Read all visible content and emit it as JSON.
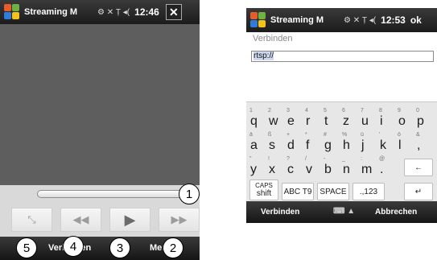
{
  "player": {
    "title": "Streaming M",
    "status_icons": "⚙ ✕ Ṭ ◂(",
    "time": "12:46",
    "close": "✕",
    "soft_left": "Verbinden",
    "soft_right": "Menü",
    "callouts": [
      "1",
      "2",
      "3",
      "4",
      "5"
    ],
    "buttons": [
      {
        "icon": "fullscreen-icon",
        "glyph": "⤡"
      },
      {
        "icon": "rewind-icon",
        "glyph": "◀◀"
      },
      {
        "icon": "play-icon",
        "glyph": "▶"
      },
      {
        "icon": "fast-forward-icon",
        "glyph": "▶▶"
      }
    ]
  },
  "connect": {
    "title": "Streaming M",
    "time": "12:53",
    "ok": "ok",
    "label": "Verbinden",
    "url_value": "rtsp://",
    "soft_left": "Verbinden",
    "soft_mid": "⌨ ▲",
    "soft_right": "Abbrechen",
    "keyboard": {
      "row1": [
        [
          "1",
          "q"
        ],
        [
          "2",
          "w"
        ],
        [
          "3",
          "e"
        ],
        [
          "4",
          "r"
        ],
        [
          "5",
          "t"
        ],
        [
          "6",
          "z"
        ],
        [
          "7",
          "u"
        ],
        [
          "8",
          "i"
        ],
        [
          "9",
          "o"
        ],
        [
          "0",
          "p"
        ]
      ],
      "row2": [
        [
          "ä",
          "a"
        ],
        [
          "ß",
          "s"
        ],
        [
          "+",
          "d"
        ],
        [
          "*",
          "f"
        ],
        [
          "#",
          "g"
        ],
        [
          "%",
          "h"
        ],
        [
          "ü",
          "j"
        ],
        [
          "'",
          "k"
        ],
        [
          "ö",
          "l"
        ],
        [
          "&",
          ","
        ]
      ],
      "row3": [
        [
          "\"",
          "y"
        ],
        [
          "!",
          "x"
        ],
        [
          "?",
          "c"
        ],
        [
          "/",
          "v"
        ],
        [
          "-",
          "b"
        ],
        [
          "_",
          "n"
        ],
        [
          ":",
          "m"
        ],
        [
          "@",
          "."
        ]
      ],
      "backspace": "←",
      "caps": "CAPS",
      "shift": "shift",
      "abc": "ABC T9",
      "space": "SPACE",
      "symbols": ".,123",
      "enter": "↵"
    }
  },
  "colors": {
    "titlebar": "#1c1c1c",
    "video": "#5e5e5e",
    "control_band": "#d9d9d9"
  }
}
